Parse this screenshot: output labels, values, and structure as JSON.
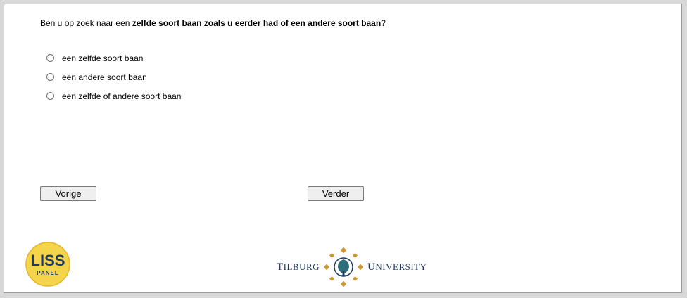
{
  "question": {
    "prefix": "Ben u op zoek naar een ",
    "emphasis": "zelfde soort baan zoals u eerder had of een andere soort baan",
    "suffix": "?"
  },
  "options": [
    {
      "label": "een zelfde soort baan"
    },
    {
      "label": "een andere soort baan"
    },
    {
      "label": "een zelfde of andere soort baan"
    }
  ],
  "nav": {
    "prev_label": "Vorige",
    "next_label": "Verder"
  },
  "footer": {
    "lis_logo_top": "LISS",
    "lis_logo_bottom": "PANEL",
    "tilburg_left_cap": "T",
    "tilburg_left_rest": "ILBURG",
    "tilburg_right_cap": "U",
    "tilburg_right_rest": "NIVERSITY"
  },
  "colors": {
    "lis_yellow": "#f4d44a",
    "tilburg_navy": "#1f3a63",
    "tilburg_gold": "#c9962f"
  }
}
